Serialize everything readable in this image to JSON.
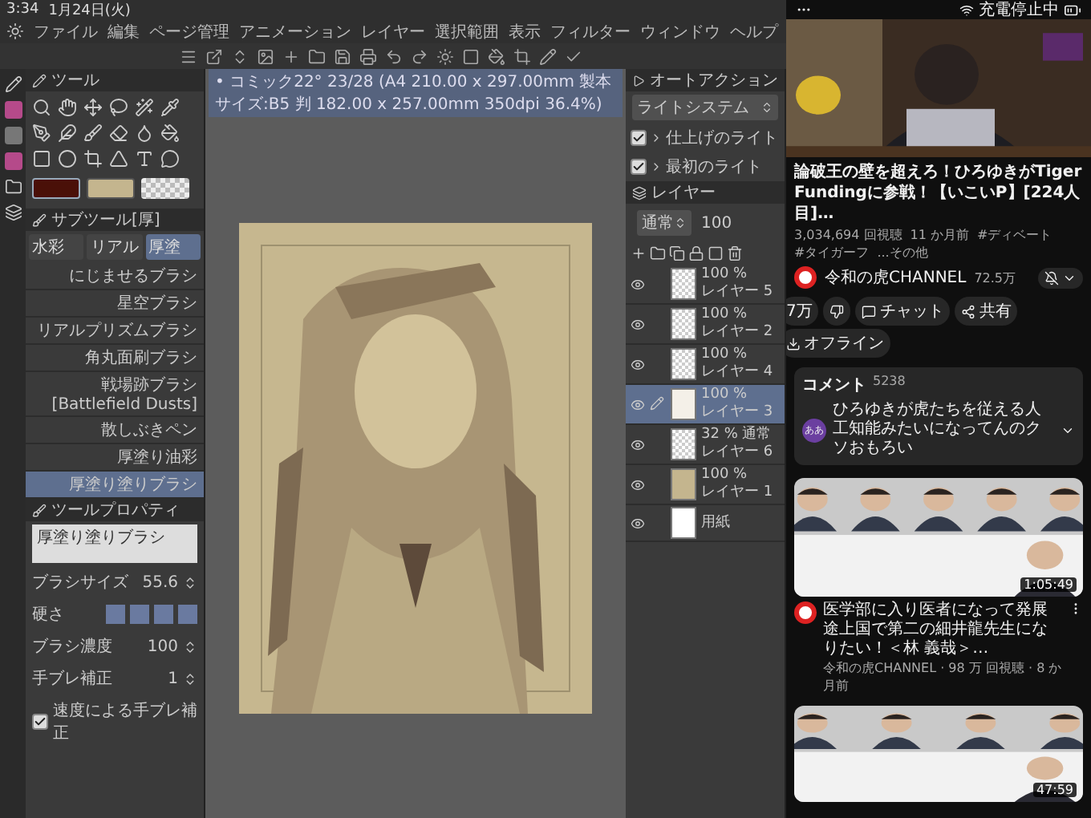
{
  "status_bar": {
    "time": "3:34",
    "date": "1月24日(火)"
  },
  "menu": [
    "ファイル",
    "編集",
    "ページ管理",
    "アニメーション",
    "レイヤー",
    "選択範囲",
    "表示",
    "フィルター",
    "ウィンドウ",
    "ヘルプ"
  ],
  "doc_tab": "• コミック22° 23/28 (A4 210.00 x 297.00mm 製本サイズ:B5 判 182.00 x 257.00mm 350dpi 36.4%)",
  "tool_panel": {
    "title": "ツール",
    "colors": [
      {
        "color": "#4a1008",
        "selected": true
      },
      {
        "color": "#c4b58e",
        "selected": false
      }
    ]
  },
  "sub_tool": {
    "title": "サブツール[厚]",
    "tabs": [
      {
        "label": "水彩",
        "selected": false
      },
      {
        "label": "リアル",
        "selected": false
      },
      {
        "label": "厚塗",
        "selected": true
      }
    ],
    "brushes": [
      {
        "label": "にじませるブラシ",
        "selected": false
      },
      {
        "label": "星空ブラシ",
        "selected": false
      },
      {
        "label": "リアルプリズムブラシ",
        "selected": false
      },
      {
        "label": "角丸面刷ブラシ",
        "selected": false
      },
      {
        "label": "戦場跡ブラシ [Battlefield Dusts]",
        "selected": false
      },
      {
        "label": "散しぶきペン",
        "selected": false
      },
      {
        "label": "厚塗り油彩",
        "selected": false
      },
      {
        "label": "厚塗り塗りブラシ",
        "selected": true
      }
    ]
  },
  "tool_property": {
    "title": "ツールプロパティ",
    "brush": "厚塗り塗りブラシ",
    "rows": [
      {
        "kind": "value",
        "label": "ブラシサイズ",
        "value": "55.6"
      },
      {
        "kind": "presets",
        "label": "硬さ"
      },
      {
        "kind": "value",
        "label": "ブラシ濃度",
        "value": "100"
      },
      {
        "kind": "value",
        "label": "手ブレ補正",
        "value": "1"
      }
    ],
    "checkbox": {
      "label": "速度による手ブレ補正",
      "checked": true
    }
  },
  "auto_action": {
    "title": "オートアクション",
    "set": "ライトシステム",
    "items": [
      {
        "label": "仕上げのライト",
        "checked": true
      },
      {
        "label": "最初のライト",
        "checked": true
      }
    ]
  },
  "layers": {
    "title": "レイヤー",
    "blend": "通常",
    "opacity": "100",
    "rows": [
      {
        "kind": "transparent",
        "opacity": "100 %",
        "name": "レイヤー 5",
        "selected": false
      },
      {
        "kind": "transparent",
        "opacity": "100 %",
        "name": "レイヤー 2",
        "selected": false
      },
      {
        "kind": "transparent",
        "opacity": "100 %",
        "name": "レイヤー 4",
        "selected": false
      },
      {
        "kind": "sketch",
        "opacity": "100 %",
        "name": "レイヤー 3",
        "selected": true
      },
      {
        "kind": "transparent",
        "opacity": "32 % 通常",
        "name": "レイヤー 6",
        "selected": false
      },
      {
        "kind": "fill",
        "opacity": "100 %",
        "name": "レイヤー 1",
        "selected": false
      },
      {
        "kind": "paper",
        "name": "用紙",
        "selected": false
      }
    ]
  },
  "youtube": {
    "status": "充電停止中",
    "video": {
      "title": "論破王の壁を超えろ！ひろゆきがTiger Fundingに参戦！【いこいP】[224人目]…",
      "meta": [
        "3,034,694 回視聴",
        "11 か月前",
        "#ディベート",
        "#タイガーフ"
      ],
      "more": "...その他",
      "channel": "令和の虎CHANNEL",
      "subscribers": "72.5万",
      "actions": [
        {
          "kind": "like",
          "label": "7万"
        },
        {
          "kind": "dislike"
        },
        {
          "kind": "chat",
          "label": "チャット"
        },
        {
          "kind": "share",
          "label": "共有"
        },
        {
          "kind": "download",
          "label": "オフライン"
        }
      ]
    },
    "comments": {
      "title": "コメント",
      "count": "5238",
      "avatar": "ああ",
      "text": "ひろゆきが虎たちを従える人工知能みたいになってんのクソおもろい"
    },
    "related": [
      {
        "duration": "1:05:49",
        "title": "医学部に入り医者になって発展途上国で第二の細井龍先生になりたい！＜林 義哉＞…",
        "meta": "令和の虎CHANNEL · 98 万 回視聴 · 8 か月前"
      },
      {
        "duration": "47:59"
      }
    ]
  }
}
